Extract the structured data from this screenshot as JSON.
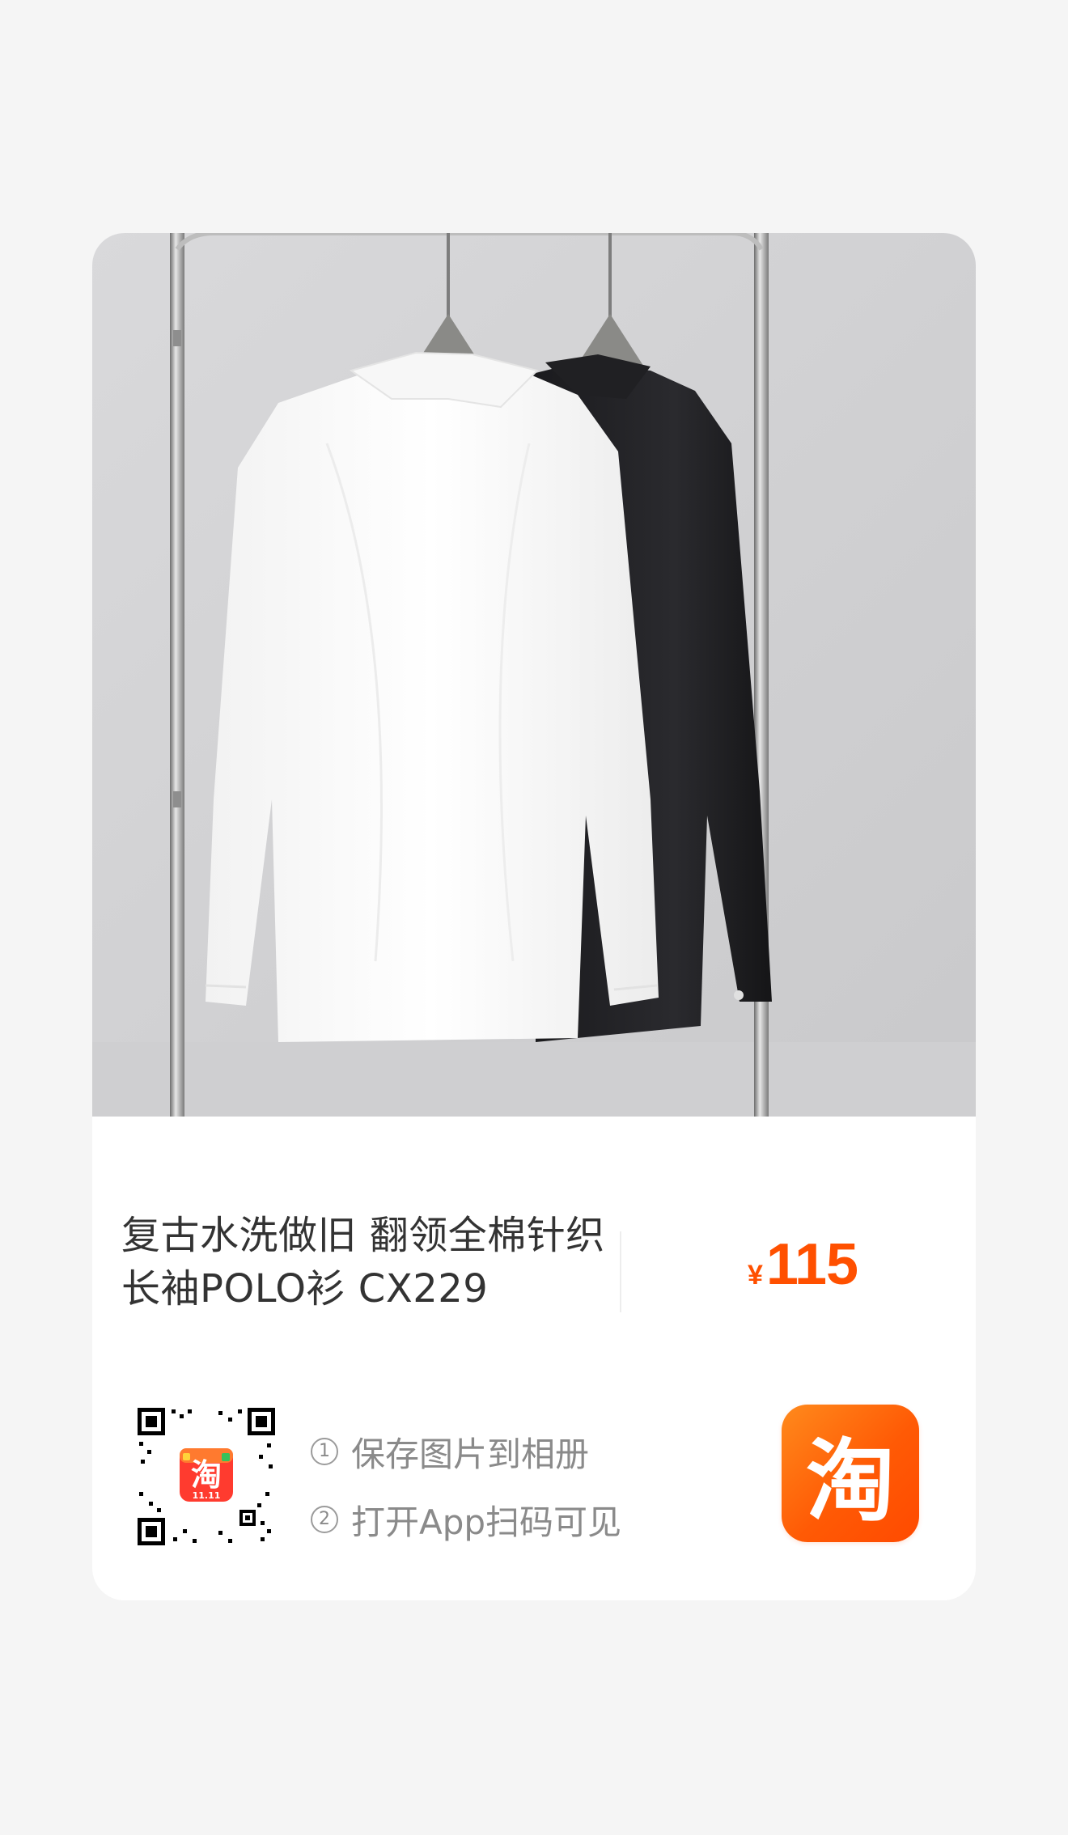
{
  "product": {
    "title": "复古水洗做旧 翻领全棉针织长袖POLO衫 CX229",
    "price_symbol": "¥",
    "price": "115",
    "photo": "white and black long-sleeve polo shirts on clothes rack"
  },
  "qr": {
    "badge_label": "淘",
    "badge_sub": "11.11"
  },
  "steps": [
    {
      "num": "1",
      "label": "保存图片到相册"
    },
    {
      "num": "2",
      "label": "打开App扫码可见"
    }
  ],
  "app": {
    "logo_char": "淘",
    "brand_color": "#ff5000"
  },
  "colors": {
    "price": "#ff5000",
    "title": "#333333",
    "hint": "#8a8a8a"
  }
}
